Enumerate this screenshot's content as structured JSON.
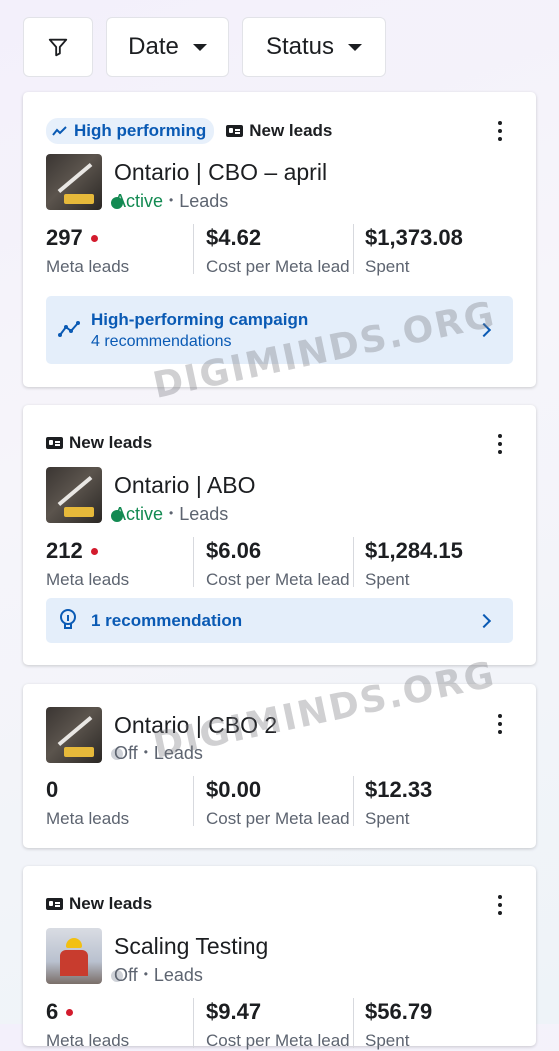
{
  "filters": {
    "icon": "filter-icon",
    "date_label": "Date",
    "status_label": "Status"
  },
  "watermark": "DIGIMINDS.ORG",
  "cards": [
    {
      "tag_high": "High performing",
      "tag_new": "New leads",
      "name": "Ontario | CBO – april",
      "status": "Active",
      "objective": "Leads",
      "metrics": [
        {
          "value": "297",
          "label": "Meta leads"
        },
        {
          "value": "$4.62",
          "label": "Cost per Meta lead"
        },
        {
          "value": "$1,373.08",
          "label": "Spent"
        }
      ],
      "rec_title": "High-performing campaign",
      "rec_desc": "4 recommendations"
    },
    {
      "tag_new": "New leads",
      "name": "Ontario | ABO",
      "status": "Active",
      "objective": "Leads",
      "metrics": [
        {
          "value": "212",
          "label": "Meta leads"
        },
        {
          "value": "$6.06",
          "label": "Cost per Meta lead"
        },
        {
          "value": "$1,284.15",
          "label": "Spent"
        }
      ],
      "rec_title": "1 recommendation"
    },
    {
      "name": "Ontario | CBO 2",
      "status": "Off",
      "objective": "Leads",
      "metrics": [
        {
          "value": "0",
          "label": "Meta leads"
        },
        {
          "value": "$0.00",
          "label": "Cost per Meta lead"
        },
        {
          "value": "$12.33",
          "label": "Spent"
        }
      ]
    },
    {
      "tag_new": "New leads",
      "name": "Scaling Testing",
      "status": "Off",
      "objective": "Leads",
      "metrics": [
        {
          "value": "6",
          "label": "Meta leads"
        },
        {
          "value": "$9.47",
          "label": "Cost per Meta lead"
        },
        {
          "value": "$56.79",
          "label": "Spent"
        }
      ]
    }
  ],
  "colors": {
    "active": "#138a52",
    "accent_blue": "#0a5ab4",
    "new_indicator": "#d31b2d"
  }
}
